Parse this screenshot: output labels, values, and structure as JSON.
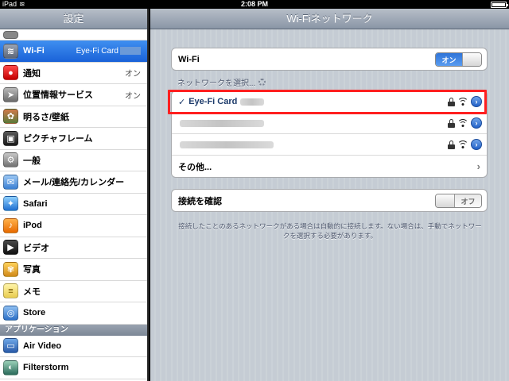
{
  "status_bar": {
    "device": "iPad",
    "time": "2:08 PM",
    "battery_level": 0.9
  },
  "left_pane": {
    "title": "設定",
    "items": [
      {
        "label": "",
        "icon": "toggle-icon",
        "partial": true
      },
      {
        "label": "Wi-Fi",
        "value": "Eye-Fi Card",
        "icon": "wifi-icon",
        "selected": true
      },
      {
        "label": "通知",
        "value": "オン",
        "icon": "notifications-icon"
      },
      {
        "label": "位置情報サービス",
        "value": "オン",
        "icon": "location-icon"
      },
      {
        "label": "明るさ/壁紙",
        "icon": "brightness-icon"
      },
      {
        "label": "ピクチャフレーム",
        "icon": "picture-frame-icon"
      },
      {
        "label": "一般",
        "icon": "gear-icon"
      },
      {
        "label": "メール/連絡先/カレンダー",
        "icon": "mail-icon"
      },
      {
        "label": "Safari",
        "icon": "safari-icon"
      },
      {
        "label": "iPod",
        "icon": "ipod-icon"
      },
      {
        "label": "ビデオ",
        "icon": "video-icon"
      },
      {
        "label": "写真",
        "icon": "photos-icon"
      },
      {
        "label": "メモ",
        "icon": "notes-icon"
      },
      {
        "label": "Store",
        "icon": "store-icon"
      }
    ],
    "apps_header": "アプリケーション",
    "apps": [
      {
        "label": "Air Video",
        "icon": "air-video-icon"
      },
      {
        "label": "Filterstorm",
        "icon": "filterstorm-icon"
      }
    ]
  },
  "right_pane": {
    "title": "Wi-Fiネットワーク",
    "wifi_row": {
      "label": "Wi-Fi",
      "switch_label": "オン",
      "state": "on"
    },
    "network_section_label": "ネットワークを選択...",
    "networks": [
      {
        "name": "Eye-Fi Card",
        "selected": true,
        "check": "✓"
      },
      {
        "name": "",
        "selected": false
      },
      {
        "name": "",
        "selected": false
      }
    ],
    "other_label": "その他...",
    "ask_row": {
      "label": "接続を確認",
      "switch_label": "オフ",
      "state": "off"
    },
    "footnote": "接続したことのあるネットワークがある場合は自動的に接続します。ない場合は、手動でネットワークを選択する必要があります。"
  },
  "colors": {
    "highlight": "#ff1f1f",
    "selected_row": "#1a62d8",
    "switch_on": "#2f74d8"
  }
}
